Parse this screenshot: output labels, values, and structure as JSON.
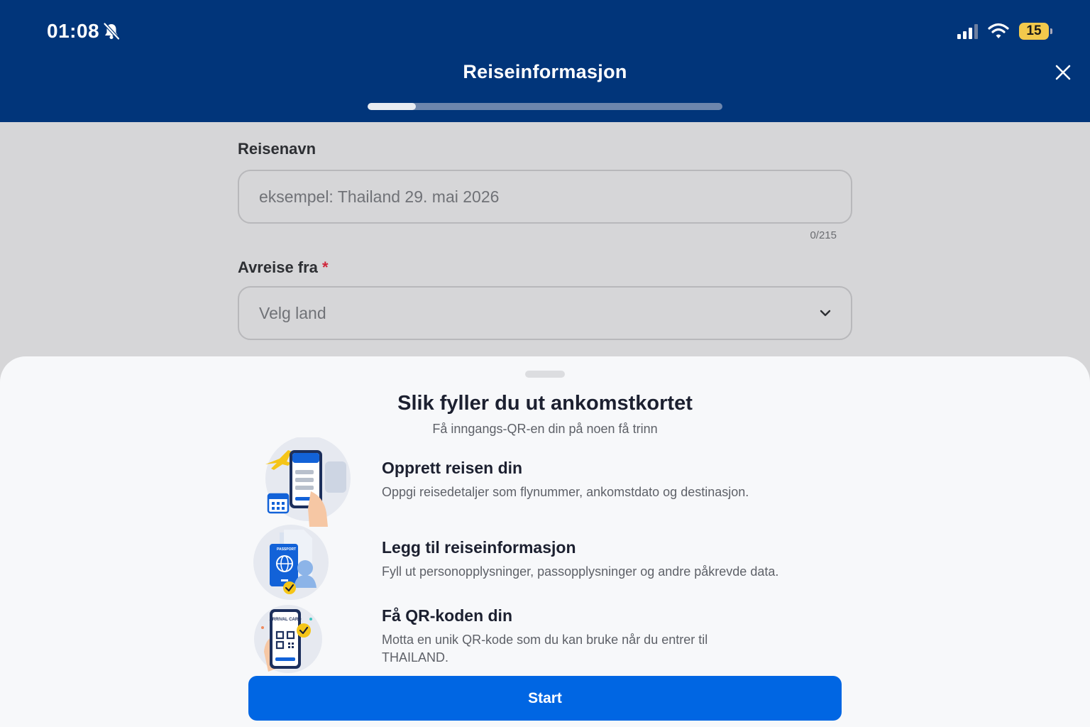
{
  "status_bar": {
    "time": "01:08",
    "battery_level": "15",
    "icons": [
      "bell-slash-icon",
      "signal-icon",
      "wifi-icon",
      "battery-icon"
    ]
  },
  "header": {
    "title": "Reiseinformasjon",
    "progress_fraction": 0.135,
    "close_icon": "close-icon"
  },
  "form": {
    "trip_name": {
      "label": "Reisenavn",
      "placeholder": "eksempel: Thailand 29. mai 2026",
      "counter": "0/215"
    },
    "departure": {
      "label": "Avreise fra",
      "required_mark": "*",
      "placeholder": "Velg land",
      "icon": "chevron-down-icon"
    }
  },
  "sheet": {
    "title": "Slik fyller du ut ankomstkortet",
    "subtitle": "Få inngangs-QR-en din på noen få trinn",
    "steps": [
      {
        "title": "Opprett reisen din",
        "description": "Oppgi reisedetaljer som flynummer, ankomstdato og destinasjon.",
        "icon": "phone-flight-icon"
      },
      {
        "title": "Legg til reiseinformasjon",
        "description": "Fyll ut personopplysninger, passopplysninger og andre påkrevde data.",
        "icon": "passport-icon"
      },
      {
        "title": "Få QR-koden din",
        "description": "Motta en unik QR-kode som du kan bruke når du entrer til THAILAND.",
        "icon": "qr-phone-icon"
      }
    ],
    "illustration_text": {
      "passport": "PASSPORT",
      "arrival_card": "ARRIVAL CARD"
    },
    "start_label": "Start"
  },
  "colors": {
    "header": "#01357a",
    "primary": "#0066e3",
    "required": "#d0263a",
    "battery": "#f2c94c"
  }
}
